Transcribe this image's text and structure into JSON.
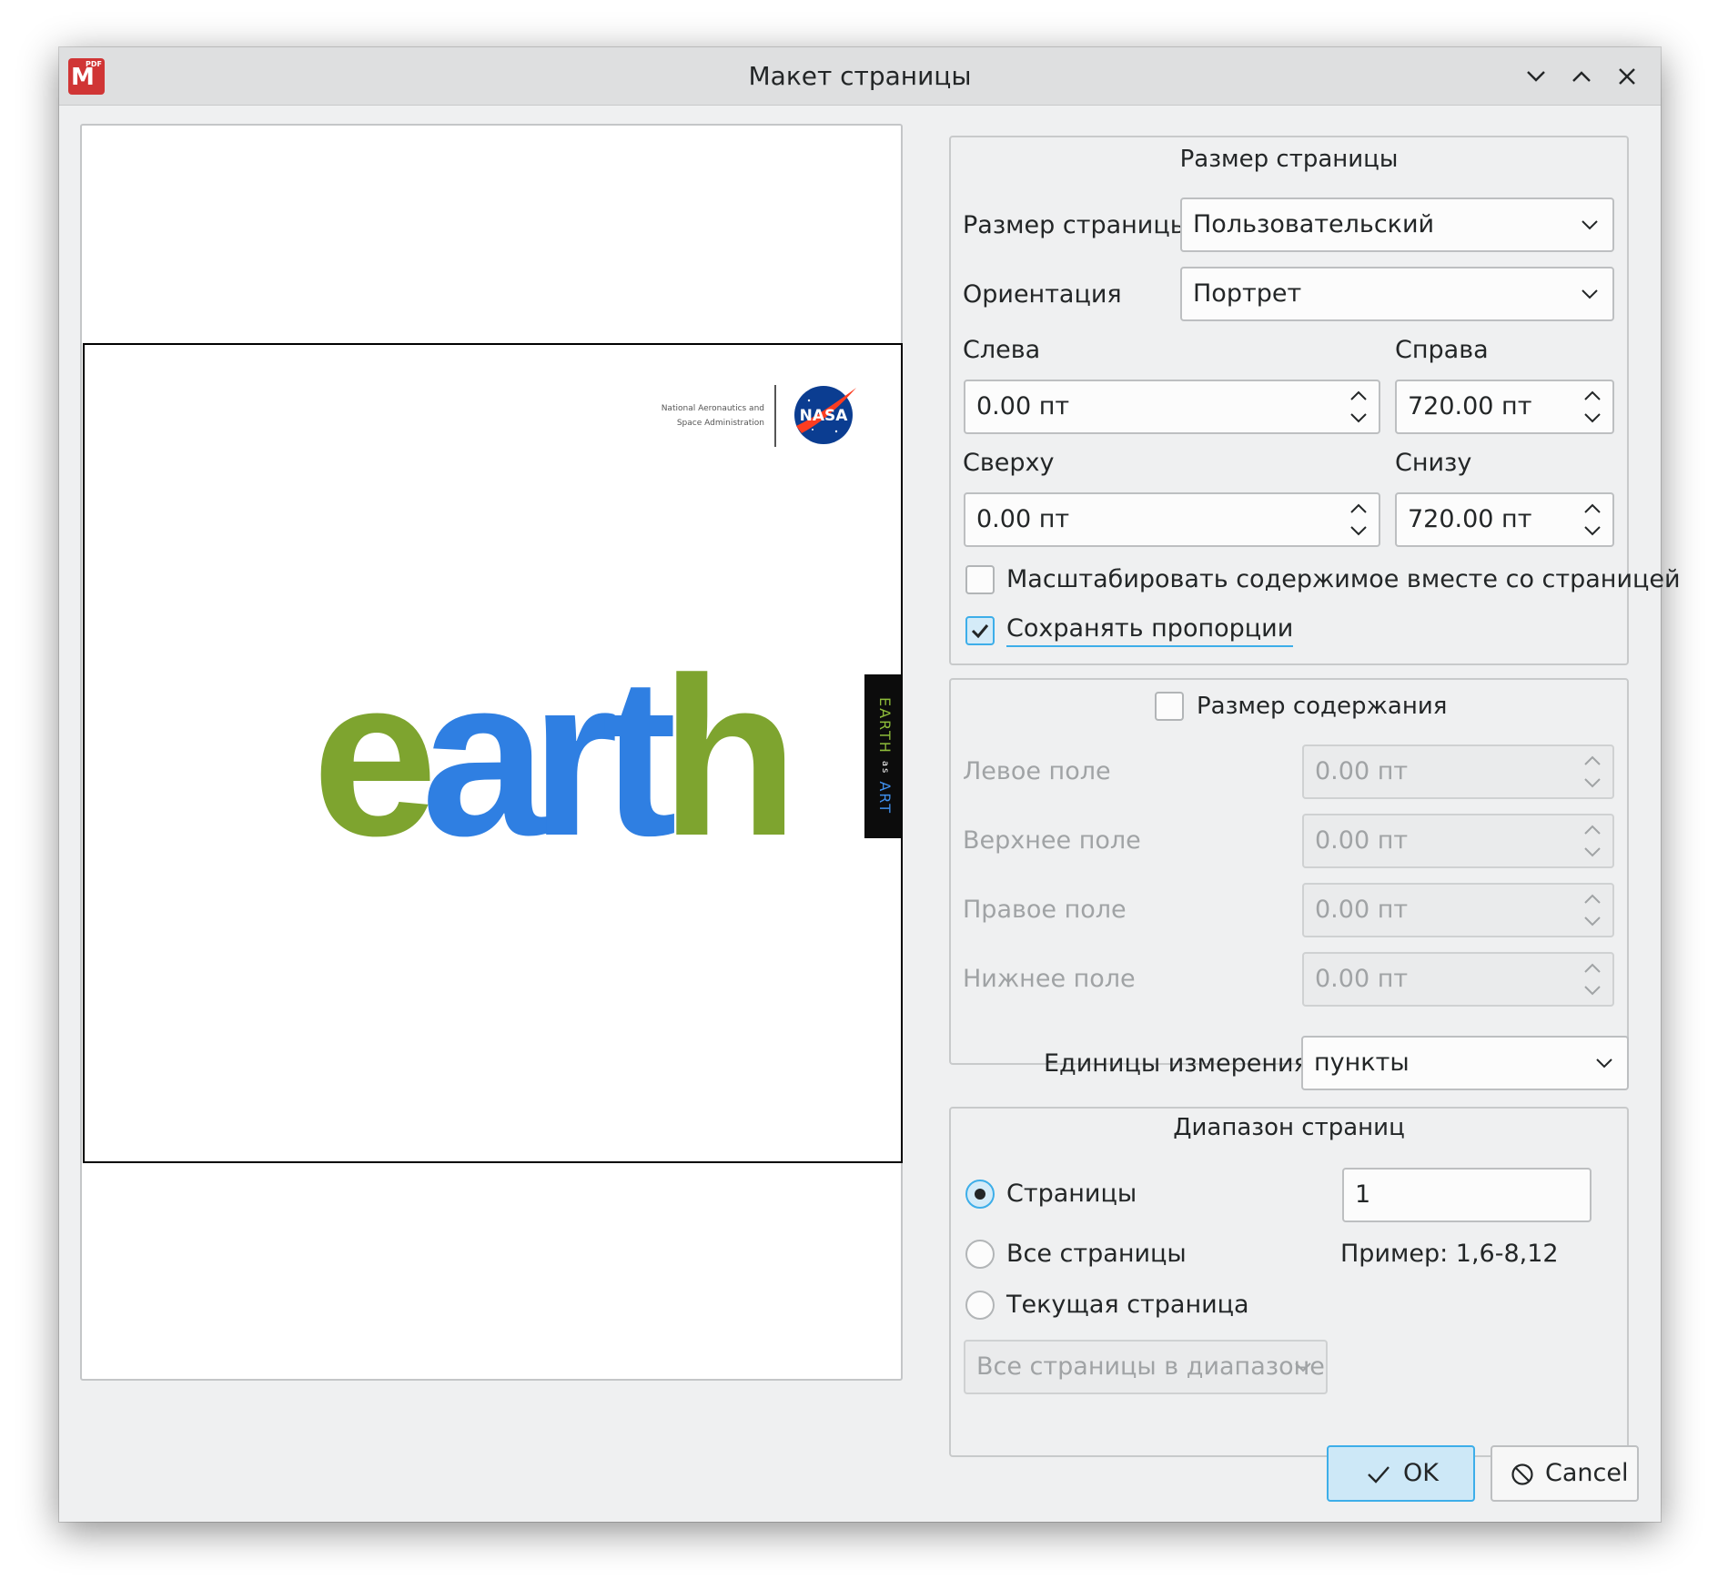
{
  "window": {
    "title": "Макет страницы",
    "app_icon_letter": "M",
    "app_icon_badge": "PDF"
  },
  "preview": {
    "nasa_agency_line1": "National Aeronautics and",
    "nasa_agency_line2": "Space Administration",
    "nasa_logo_text": "NASA",
    "earth_word_e": "e",
    "earth_word_art": "art",
    "earth_word_h": "h",
    "side_strip_earth": "EARTH",
    "side_strip_as": "as",
    "side_strip_art": "ART"
  },
  "page_size": {
    "group_title": "Размер страницы",
    "size_label": "Размер страницы",
    "size_value": "Пользовательский",
    "orientation_label": "Ориентация",
    "orientation_value": "Портрет",
    "left_label": "Слева",
    "left_value": "0.00 пт",
    "right_label": "Справа",
    "right_value": "720.00 пт",
    "top_label": "Сверху",
    "top_value": "0.00 пт",
    "bottom_label": "Снизу",
    "bottom_value": "720.00 пт",
    "scale_content_label": "Масштабировать содержимое вместе со страницей",
    "scale_content_checked": false,
    "keep_ratio_label": "Сохранять пропорции",
    "keep_ratio_checked": true
  },
  "content_size": {
    "group_title": "Размер содержания",
    "enabled": false,
    "left_margin_label": "Левое поле",
    "left_margin_value": "0.00 пт",
    "top_margin_label": "Верхнее поле",
    "top_margin_value": "0.00 пт",
    "right_margin_label": "Правое поле",
    "right_margin_value": "0.00 пт",
    "bottom_margin_label": "Нижнее поле",
    "bottom_margin_value": "0.00 пт"
  },
  "units": {
    "label": "Единицы измерения",
    "value": "пункты"
  },
  "page_range": {
    "group_title": "Диапазон страниц",
    "pages_label": "Страницы",
    "pages_value": "1",
    "example_text": "Пример: 1,6-8,12",
    "all_pages_label": "Все страницы",
    "current_page_label": "Текущая страница",
    "selected": "pages",
    "subset_value": "Все страницы в диапазоне"
  },
  "buttons": {
    "ok_label": "OK",
    "cancel_label": "Cancel"
  },
  "colors": {
    "accent": "#3daee9",
    "earth_green": "#7ea42f",
    "earth_blue": "#2f7fe2",
    "app_icon_red": "#d03535",
    "nasa_blue": "#0b3d91",
    "nasa_red": "#fc3d21"
  },
  "icons": {
    "minimize": "chevron-down-icon",
    "maximize": "chevron-up-icon",
    "close": "close-icon",
    "ok": "checkmark-icon",
    "cancel": "cancel-circle-icon"
  }
}
